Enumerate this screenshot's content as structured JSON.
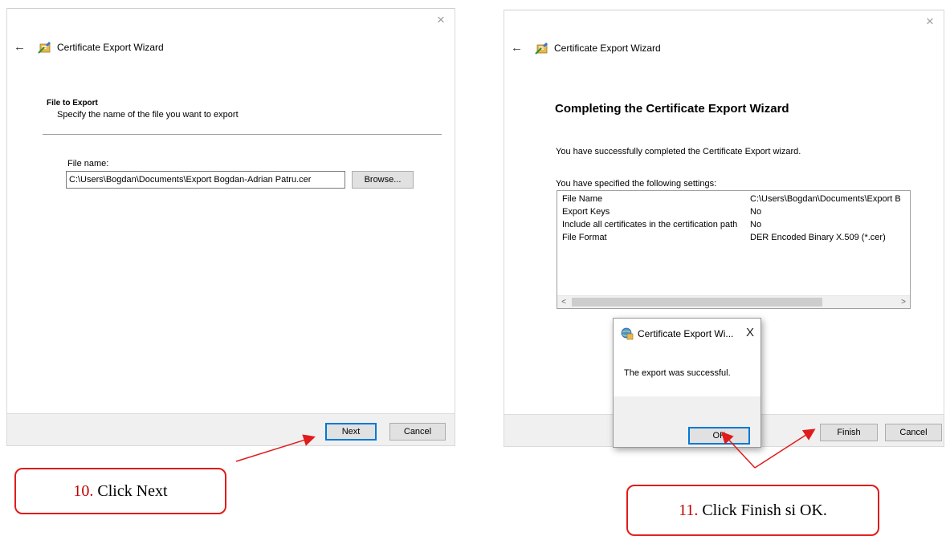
{
  "left_wizard": {
    "window_title": "Certificate Export Wizard",
    "close_glyph": "×",
    "back_glyph": "←",
    "section_title": "File to Export",
    "section_subtitle": "Specify the name of the file you want to export",
    "file_name_label": "File name:",
    "file_name_value": "C:\\Users\\Bogdan\\Documents\\Export Bogdan-Adrian Patru.cer",
    "browse_label": "Browse...",
    "next_label": "Next",
    "cancel_label": "Cancel",
    "icons": {
      "back": "back-arrow-icon",
      "wizard": "certificate-wizard-icon",
      "close": "close-icon"
    }
  },
  "right_wizard": {
    "window_title": "Certificate Export Wizard",
    "close_glyph": "×",
    "back_glyph": "←",
    "heading": "Completing the Certificate Export Wizard",
    "success_text": "You have successfully completed the Certificate Export wizard.",
    "settings_label": "You have specified the following settings:",
    "settings": [
      {
        "key": "File Name",
        "value": "C:\\Users\\Bogdan\\Documents\\Export B"
      },
      {
        "key": "Export Keys",
        "value": "No"
      },
      {
        "key": "Include all certificates in the certification path",
        "value": "No"
      },
      {
        "key": "File Format",
        "value": "DER Encoded Binary X.509 (*.cer)"
      }
    ],
    "scroll_left_glyph": "<",
    "scroll_right_glyph": ">",
    "finish_label": "Finish",
    "cancel_label": "Cancel"
  },
  "message_box": {
    "title": "Certificate Export Wi...",
    "close_glyph": "X",
    "message": "The export was successful.",
    "ok_label": "OK",
    "icon": "certificate-globe-icon"
  },
  "callouts": {
    "step10_number": "10.",
    "step10_text": "Click Next",
    "step11_number": "11.",
    "step11_text": "Click Finish si OK."
  },
  "colors": {
    "accent_border": "#0078d7",
    "annotation_red": "#e01b1b",
    "footer_bg": "#f0f0f0"
  }
}
